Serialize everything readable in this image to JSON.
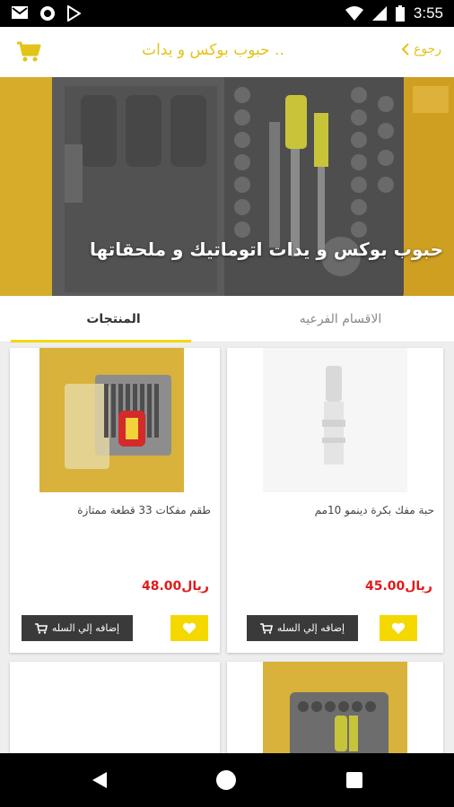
{
  "status_bar": {
    "time": "3:55"
  },
  "app_bar": {
    "title": "حبوب بوكس و يدات ..",
    "back_label": "رجوع"
  },
  "hero": {
    "title": "حبوب بوكس و يدات اتوماتيك و ملحقاتها"
  },
  "tabs": [
    {
      "label": "المنتجات",
      "active": true
    },
    {
      "label": "الاقسام الفرعيه",
      "active": false
    }
  ],
  "products": [
    {
      "name": "حبة مفك بكرة دينمو 10مم",
      "price": "45.00ريال",
      "add_label": "إضافه إلي السله"
    },
    {
      "name": "طقم مفكات 33 قطعة ممتازة",
      "price": "48.00ريال",
      "add_label": "إضافه إلي السله"
    }
  ],
  "colors": {
    "accent": "#f5d800",
    "title_color": "#e2c31a",
    "price": "#e01a1a",
    "button_dark": "#3a3a3a"
  }
}
